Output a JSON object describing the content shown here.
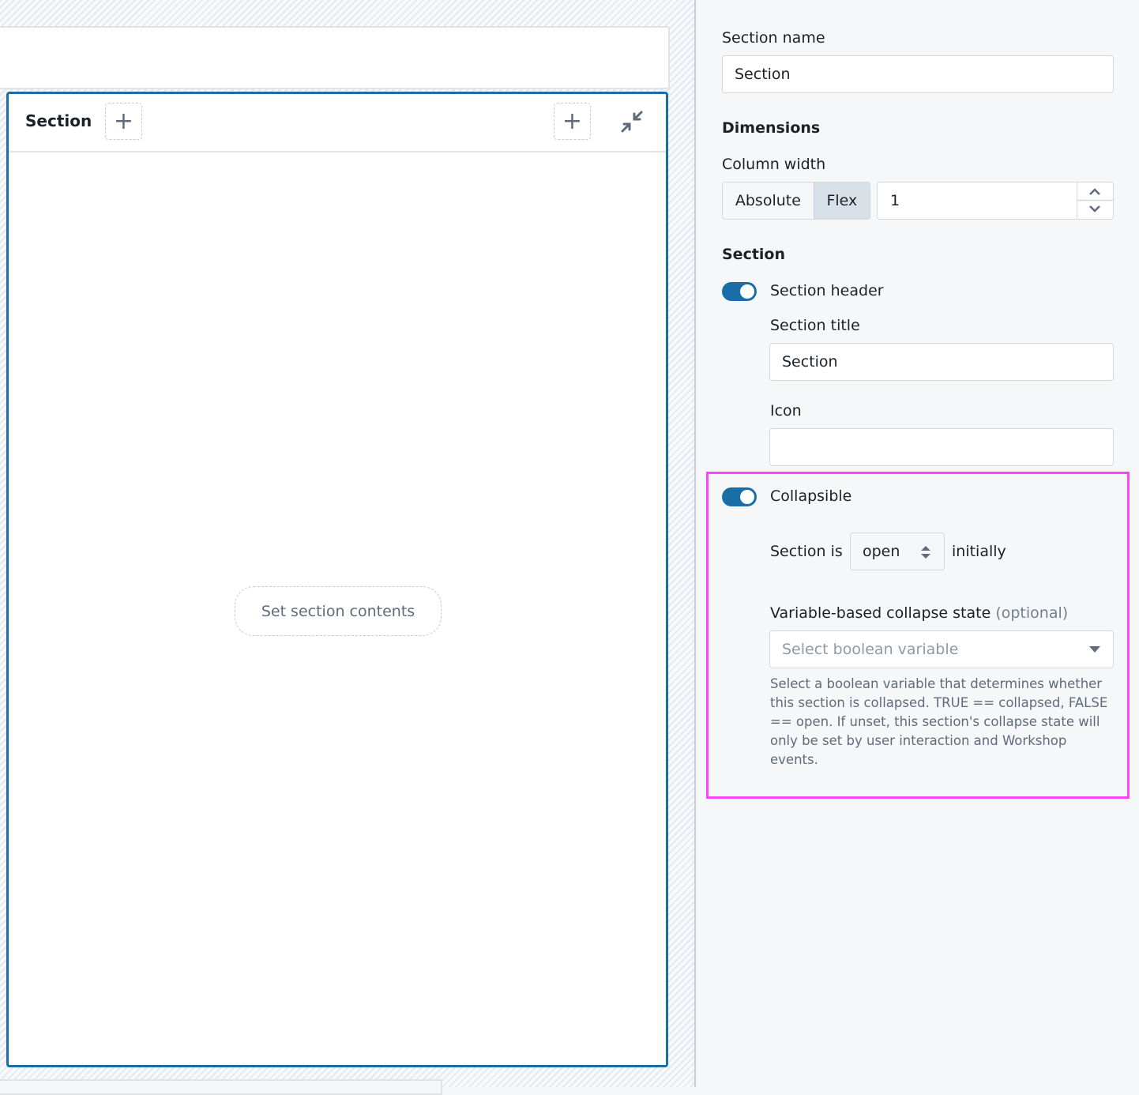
{
  "canvas": {
    "section_title": "Section",
    "set_contents_label": "Set section contents"
  },
  "panel": {
    "section_name_label": "Section name",
    "section_name_value": "Section",
    "dimensions_heading": "Dimensions",
    "column_width_label": "Column width",
    "width_modes": [
      "Absolute",
      "Flex"
    ],
    "selected_mode": "Flex",
    "width_value": "1",
    "section_heading": "Section",
    "section_header_label": "Section header",
    "section_header_on": true,
    "section_title_label": "Section title",
    "section_title_value": "Section",
    "icon_label": "Icon",
    "icon_value": "",
    "collapsible_label": "Collapsible",
    "collapsible_on": true,
    "section_is_label": "Section is",
    "initial_state": "open",
    "initially_label": "initially",
    "variable_label": "Variable-based collapse state",
    "optional_label": "(optional)",
    "variable_placeholder": "Select boolean variable",
    "help_text": "Select a boolean variable that determines whether this section is collapsed. TRUE == collapsed, FALSE == open. If unset, this section's collapse state will only be set by user interaction and Workshop events."
  },
  "colors": {
    "accent": "#1a6ea8",
    "highlight": "#ff44ff",
    "panel_bg": "#f6f7f9"
  }
}
